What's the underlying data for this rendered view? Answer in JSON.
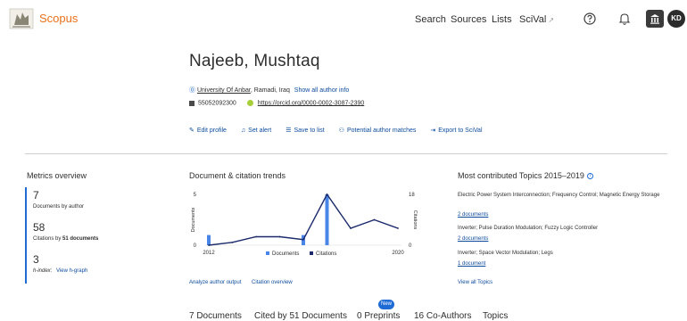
{
  "header": {
    "brand": "Scopus",
    "nav": [
      "Search",
      "Sources",
      "Lists",
      "SciVal"
    ],
    "external_mark": "↗",
    "avatar_initials": "KD",
    "brand_color": "#e9711c",
    "icons": [
      "help-icon",
      "bell-icon",
      "institution-icon"
    ]
  },
  "profile": {
    "name": "Najeeb, Mushtaq",
    "affiliation": "University Of Anbar",
    "location": ", Ramadi, Iraq",
    "show_info": "Show all author info",
    "scopus_id": "55052092300",
    "orcid": "https://orcid.org/0000-0002-3087-2390"
  },
  "actions": [
    "Edit profile",
    "Set alert",
    "Save to list",
    "Potential author matches",
    "Export to SciVal"
  ],
  "metrics": {
    "title": "Metrics overview",
    "documents": "7",
    "documents_label": "Documents by author",
    "citations": "58",
    "citations_label_pre": "Citations by ",
    "citations_label_bold": "51 documents",
    "hindex": "3",
    "hindex_label": "h-index:",
    "hgraph": "View h-graph"
  },
  "trends": {
    "title": "Document & citation trends",
    "ylabel_left": "Documents",
    "ylabel_right": "Citations",
    "legend_docs": "Documents",
    "legend_cites": "Citations",
    "link_analyze": "Analyze author output",
    "link_overview": "Citation overview"
  },
  "chart_data": {
    "type": "bar",
    "x": [
      "2012",
      "2013",
      "2014",
      "2015",
      "2016",
      "2017",
      "2018",
      "2019",
      "2020"
    ],
    "xticks": [
      "2012",
      "2020"
    ],
    "series": [
      {
        "name": "Documents",
        "type": "bar",
        "values": [
          1,
          0,
          0,
          0,
          1,
          5,
          0,
          0,
          0
        ],
        "color": "#4a86e8"
      },
      {
        "name": "Citations",
        "type": "line",
        "values": [
          0,
          1,
          3,
          3,
          2,
          18,
          6,
          9,
          6
        ],
        "color": "#1b2a6b"
      }
    ],
    "ylim_left": [
      0,
      5
    ],
    "yticks_left": [
      "5",
      "0"
    ],
    "ylim_right": [
      0,
      18
    ],
    "yticks_right": [
      "18",
      "0"
    ]
  },
  "topics": {
    "title": "Most contributed Topics 2015–2019",
    "items": [
      {
        "name": "Electric Power System Interconnection; Frequency Control; Magnetic Energy Storage",
        "docs": "2 documents"
      },
      {
        "name": "Inverter; Pulse Duration Modulation; Fuzzy Logic Controller",
        "docs": "2 documents"
      },
      {
        "name": "Inverter; Space Vector Modulation; Legs",
        "docs": "1 document"
      }
    ],
    "view_all": "View all Topics"
  },
  "tabs": {
    "documents": "7 Documents",
    "cited_by": "Cited by 51 Documents",
    "preprints": "0 Preprints",
    "coauthors": "16 Co-Authors",
    "topics": "Topics",
    "new_badge": "New"
  }
}
